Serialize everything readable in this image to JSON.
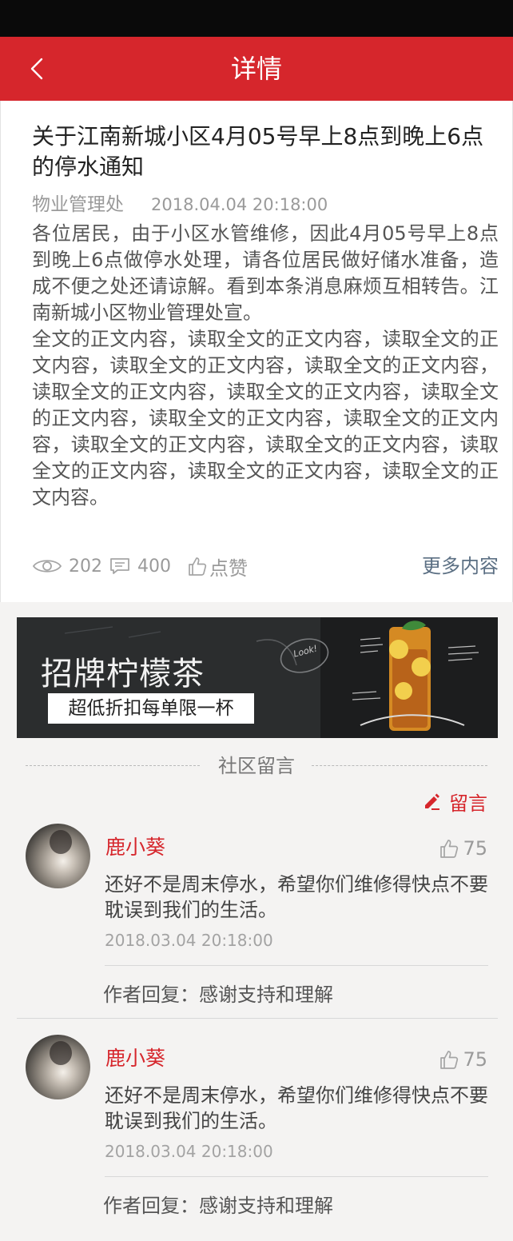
{
  "nav": {
    "title": "详情",
    "back_icon": "chevron-left-icon"
  },
  "article": {
    "title": "关于江南新城小区4月05号早上8点到晚上6点的停水通知",
    "source": "物业管理处",
    "time": "2018.04.04  20:18:00",
    "paragraph1": "各位居民，由于小区水管维修，因此4月05号早上8点到晚上6点做停水处理，请各位居民做好储水准备，造成不便之处还请谅解。看到本条消息麻烦互相转告。江南新城小区物业管理处宣。",
    "paragraph2": "全文的正文内容，读取全文的正文内容，读取全文的正文内容，读取全文的正文内容，读取全文的正文内容，读取全文的正文内容，读取全文的正文内容，读取全文的正文内容，读取全文的正文内容，读取全文的正文内容，读取全文的正文内容，读取全文的正文内容，读取全文的正文内容，读取全文的正文内容，读取全文的正文内容。",
    "views": "202",
    "comments": "400",
    "like_label": "点赞",
    "more_label": "更多内容"
  },
  "banner": {
    "title": "招牌柠檬茶",
    "subtitle": "超低折扣每单限一杯",
    "badge": "Look!"
  },
  "comments_section": {
    "label": "社区留言",
    "write_label": "留言",
    "items": [
      {
        "name": "鹿小葵",
        "likes": "75",
        "text": "还好不是周末停水，希望你们维修得快点不要耽误到我们的生活。",
        "time": "2018.03.04  20:18:00",
        "reply": "作者回复：感谢支持和理解"
      },
      {
        "name": "鹿小葵",
        "likes": "75",
        "text": "还好不是周末停水，希望你们维修得快点不要耽误到我们的生活。",
        "time": "2018.03.04  20:18:00",
        "reply": "作者回复：感谢支持和理解"
      }
    ]
  },
  "colors": {
    "brand_red": "#d6262c",
    "link_blue_gray": "#5b6f83"
  }
}
